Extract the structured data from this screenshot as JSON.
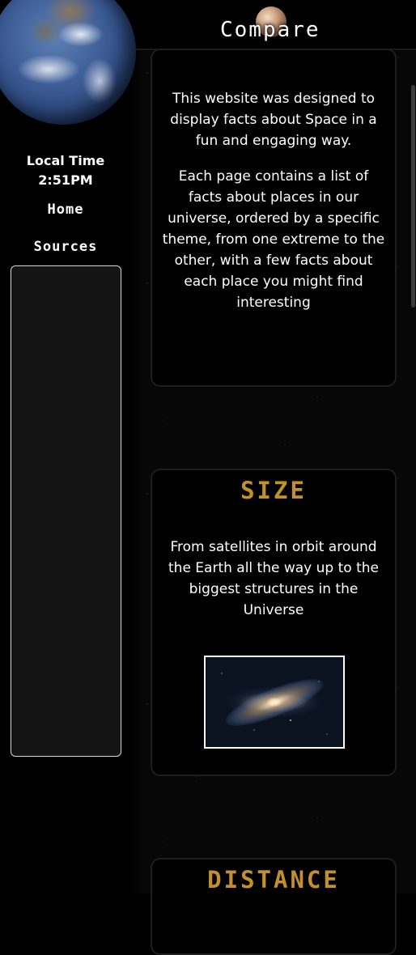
{
  "header": {
    "title": "Compare",
    "planet_icon": "pluto-icon"
  },
  "sidebar": {
    "local_time_label": "Local Time",
    "local_time_value": "2:51PM",
    "nav": [
      {
        "label": "Home"
      },
      {
        "label": "Sources"
      }
    ],
    "earth_icon": "earth-icon"
  },
  "intro": {
    "paragraph_1": "This website was designed to display facts about Space in a fun and engaging way.",
    "paragraph_2": "Each page contains a list of facts about places in our universe, ordered by a specific theme, from one extreme to the other, with a few facts about each place you might find interesting"
  },
  "sections": [
    {
      "title": "SIZE",
      "description": "From satellites in orbit around the Earth all the way up to the biggest structures in the Universe",
      "image": "galaxy-image"
    },
    {
      "title": "DISTANCE"
    }
  ],
  "colors": {
    "accent": "#c2902f",
    "background": "#000000",
    "card_border": "#1e1e1e",
    "panel": "#141414"
  }
}
